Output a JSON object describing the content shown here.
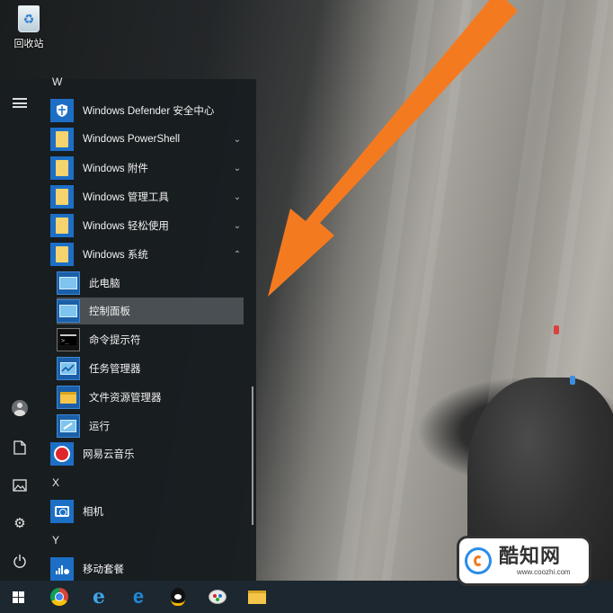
{
  "desktop": {
    "recycle_bin_label": "回收站"
  },
  "start_menu": {
    "rail": {
      "icons": [
        "hamburger-icon",
        "user-avatar-icon",
        "documents-icon",
        "pictures-icon",
        "settings-icon",
        "power-icon"
      ]
    },
    "letters": {
      "w": "W",
      "x": "X",
      "y": "Y"
    },
    "items": [
      {
        "label": "Windows Defender 安全中心",
        "icon": "shield-icon"
      },
      {
        "label": "Windows PowerShell",
        "icon": "folder-icon",
        "chevron": "down"
      },
      {
        "label": "Windows 附件",
        "icon": "folder-icon",
        "chevron": "down"
      },
      {
        "label": "Windows 管理工具",
        "icon": "folder-icon",
        "chevron": "down"
      },
      {
        "label": "Windows 轻松使用",
        "icon": "folder-icon",
        "chevron": "down"
      },
      {
        "label": "Windows 系统",
        "icon": "folder-icon",
        "chevron": "up",
        "expanded": true
      },
      {
        "label": "此电脑",
        "icon": "this-pc-icon"
      },
      {
        "label": "控制面板",
        "icon": "control-panel-icon",
        "selected": true
      },
      {
        "label": "命令提示符",
        "icon": "command-prompt-icon"
      },
      {
        "label": "任务管理器",
        "icon": "task-manager-icon"
      },
      {
        "label": "文件资源管理器",
        "icon": "file-explorer-icon"
      },
      {
        "label": "运行",
        "icon": "run-icon"
      },
      {
        "label": "网易云音乐",
        "icon": "netease-music-icon"
      },
      {
        "label": "相机",
        "icon": "camera-icon"
      },
      {
        "label": "移动套餐",
        "icon": "mobile-plans-icon"
      }
    ]
  },
  "taskbar": {
    "icons": [
      "windows-start-icon",
      "chrome-icon",
      "internet-explorer-icon",
      "edge-icon",
      "qq-icon",
      "paint-icon",
      "file-explorer-icon"
    ]
  },
  "watermark": {
    "title": "酷知网",
    "url": "www.coozhi.com"
  },
  "colors": {
    "accent": "#1d6fc6",
    "arrow": "#f47a20",
    "menu_bg": "#181d20",
    "selected_bg": "#4a4f53",
    "taskbar_bg": "#1c2730"
  }
}
